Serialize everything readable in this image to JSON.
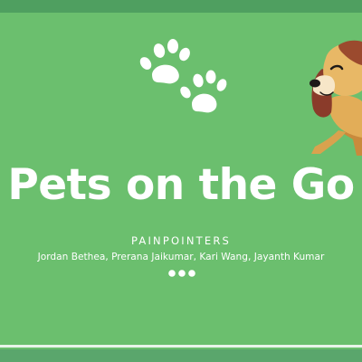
{
  "slide": {
    "title": "Pets on the Go",
    "team_name": "PAINPOINTERS",
    "members": "Jordan Bethea, Prerana Jaikumar, Kari Wang, Jayanth Kumar"
  },
  "icons": {
    "paws": "paw-prints-icon",
    "dog": "dog-illustration",
    "more": "more-dots-icon"
  },
  "colors": {
    "background": "#6bbf6e",
    "band": "#4f9f60",
    "text": "#ffffff"
  }
}
